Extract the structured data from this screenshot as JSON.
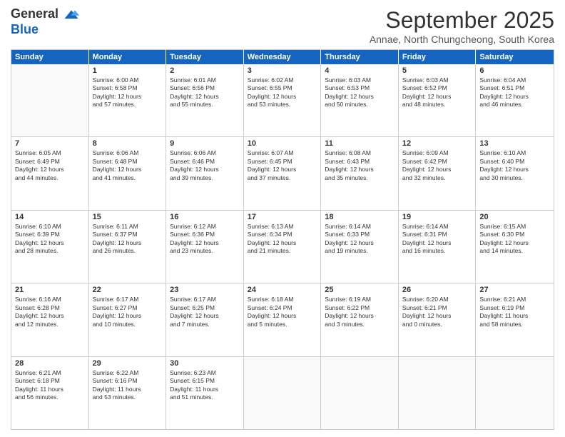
{
  "logo": {
    "general": "General",
    "blue": "Blue"
  },
  "title": "September 2025",
  "subtitle": "Annae, North Chungcheong, South Korea",
  "weekdays": [
    "Sunday",
    "Monday",
    "Tuesday",
    "Wednesday",
    "Thursday",
    "Friday",
    "Saturday"
  ],
  "weeks": [
    [
      {
        "day": "",
        "content": ""
      },
      {
        "day": "1",
        "content": "Sunrise: 6:00 AM\nSunset: 6:58 PM\nDaylight: 12 hours\nand 57 minutes."
      },
      {
        "day": "2",
        "content": "Sunrise: 6:01 AM\nSunset: 6:56 PM\nDaylight: 12 hours\nand 55 minutes."
      },
      {
        "day": "3",
        "content": "Sunrise: 6:02 AM\nSunset: 6:55 PM\nDaylight: 12 hours\nand 53 minutes."
      },
      {
        "day": "4",
        "content": "Sunrise: 6:03 AM\nSunset: 6:53 PM\nDaylight: 12 hours\nand 50 minutes."
      },
      {
        "day": "5",
        "content": "Sunrise: 6:03 AM\nSunset: 6:52 PM\nDaylight: 12 hours\nand 48 minutes."
      },
      {
        "day": "6",
        "content": "Sunrise: 6:04 AM\nSunset: 6:51 PM\nDaylight: 12 hours\nand 46 minutes."
      }
    ],
    [
      {
        "day": "7",
        "content": "Sunrise: 6:05 AM\nSunset: 6:49 PM\nDaylight: 12 hours\nand 44 minutes."
      },
      {
        "day": "8",
        "content": "Sunrise: 6:06 AM\nSunset: 6:48 PM\nDaylight: 12 hours\nand 41 minutes."
      },
      {
        "day": "9",
        "content": "Sunrise: 6:06 AM\nSunset: 6:46 PM\nDaylight: 12 hours\nand 39 minutes."
      },
      {
        "day": "10",
        "content": "Sunrise: 6:07 AM\nSunset: 6:45 PM\nDaylight: 12 hours\nand 37 minutes."
      },
      {
        "day": "11",
        "content": "Sunrise: 6:08 AM\nSunset: 6:43 PM\nDaylight: 12 hours\nand 35 minutes."
      },
      {
        "day": "12",
        "content": "Sunrise: 6:09 AM\nSunset: 6:42 PM\nDaylight: 12 hours\nand 32 minutes."
      },
      {
        "day": "13",
        "content": "Sunrise: 6:10 AM\nSunset: 6:40 PM\nDaylight: 12 hours\nand 30 minutes."
      }
    ],
    [
      {
        "day": "14",
        "content": "Sunrise: 6:10 AM\nSunset: 6:39 PM\nDaylight: 12 hours\nand 28 minutes."
      },
      {
        "day": "15",
        "content": "Sunrise: 6:11 AM\nSunset: 6:37 PM\nDaylight: 12 hours\nand 26 minutes."
      },
      {
        "day": "16",
        "content": "Sunrise: 6:12 AM\nSunset: 6:36 PM\nDaylight: 12 hours\nand 23 minutes."
      },
      {
        "day": "17",
        "content": "Sunrise: 6:13 AM\nSunset: 6:34 PM\nDaylight: 12 hours\nand 21 minutes."
      },
      {
        "day": "18",
        "content": "Sunrise: 6:14 AM\nSunset: 6:33 PM\nDaylight: 12 hours\nand 19 minutes."
      },
      {
        "day": "19",
        "content": "Sunrise: 6:14 AM\nSunset: 6:31 PM\nDaylight: 12 hours\nand 16 minutes."
      },
      {
        "day": "20",
        "content": "Sunrise: 6:15 AM\nSunset: 6:30 PM\nDaylight: 12 hours\nand 14 minutes."
      }
    ],
    [
      {
        "day": "21",
        "content": "Sunrise: 6:16 AM\nSunset: 6:28 PM\nDaylight: 12 hours\nand 12 minutes."
      },
      {
        "day": "22",
        "content": "Sunrise: 6:17 AM\nSunset: 6:27 PM\nDaylight: 12 hours\nand 10 minutes."
      },
      {
        "day": "23",
        "content": "Sunrise: 6:17 AM\nSunset: 6:25 PM\nDaylight: 12 hours\nand 7 minutes."
      },
      {
        "day": "24",
        "content": "Sunrise: 6:18 AM\nSunset: 6:24 PM\nDaylight: 12 hours\nand 5 minutes."
      },
      {
        "day": "25",
        "content": "Sunrise: 6:19 AM\nSunset: 6:22 PM\nDaylight: 12 hours\nand 3 minutes."
      },
      {
        "day": "26",
        "content": "Sunrise: 6:20 AM\nSunset: 6:21 PM\nDaylight: 12 hours\nand 0 minutes."
      },
      {
        "day": "27",
        "content": "Sunrise: 6:21 AM\nSunset: 6:19 PM\nDaylight: 11 hours\nand 58 minutes."
      }
    ],
    [
      {
        "day": "28",
        "content": "Sunrise: 6:21 AM\nSunset: 6:18 PM\nDaylight: 11 hours\nand 56 minutes."
      },
      {
        "day": "29",
        "content": "Sunrise: 6:22 AM\nSunset: 6:16 PM\nDaylight: 11 hours\nand 53 minutes."
      },
      {
        "day": "30",
        "content": "Sunrise: 6:23 AM\nSunset: 6:15 PM\nDaylight: 11 hours\nand 51 minutes."
      },
      {
        "day": "",
        "content": ""
      },
      {
        "day": "",
        "content": ""
      },
      {
        "day": "",
        "content": ""
      },
      {
        "day": "",
        "content": ""
      }
    ]
  ]
}
